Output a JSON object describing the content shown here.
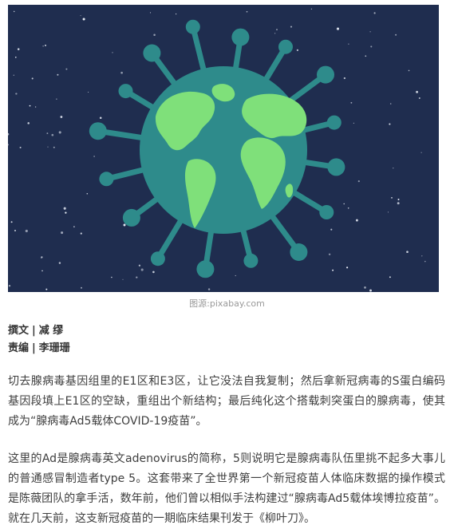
{
  "image": {
    "subject": "globe-coronavirus-illustration",
    "colors": {
      "background": "#1f2d4f",
      "virus": "#2e8b8b",
      "land": "#7fe07a",
      "stars": "#e9eef7"
    },
    "caption": "图源:pixabay.com"
  },
  "byline": {
    "author_label": "撰文",
    "author_name": "减 缪",
    "editor_label": "责编",
    "editor_name": "李珊珊",
    "separator": "|"
  },
  "article": {
    "paragraphs": [
      "切去腺病毒基因组里的E1区和E3区，让它没法自我复制；然后拿新冠病毒的S蛋白编码基因段填上E1区的空缺，重组出个新结构；最后纯化这个搭载刺突蛋白的腺病毒，使其成为“腺病毒Ad5载体COVID-19疫苗”。",
      "这里的Ad是腺病毒英文adenovirus的简称，5则说明它是腺病毒队伍里挑不起多大事儿的普通感冒制造者type 5。这套带来了全世界第一个新冠疫苗人体临床数据的操作模式是陈薇团队的拿手活，数年前，他们曾以相似手法构建过“腺病毒Ad5载体埃博拉疫苗”。就在几天前，这支新冠疫苗的一期临床结果刊发于《柳叶刀》。"
    ]
  }
}
